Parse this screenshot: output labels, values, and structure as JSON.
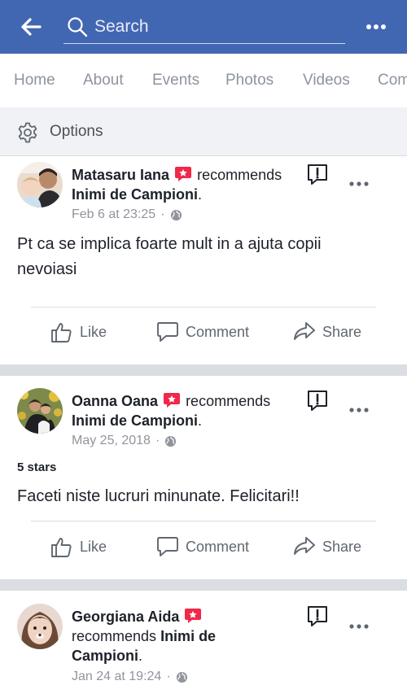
{
  "header": {
    "back_icon": "arrow-left-icon",
    "search_placeholder": "Search",
    "more_icon": "more-horizontal-icon",
    "background_color": "#4267b2"
  },
  "tabs": [
    "Home",
    "About",
    "Events",
    "Photos",
    "Videos",
    "Com"
  ],
  "options": {
    "label": "Options",
    "icon": "gear-icon"
  },
  "actions": {
    "like": "Like",
    "comment": "Comment",
    "share": "Share"
  },
  "posts": [
    {
      "author": "Matasaru Iana",
      "recommends": "recommends",
      "page": "Inimi de Campioni",
      "period": ".",
      "timestamp": "Feb 6 at 23:25",
      "separator": "·",
      "body": "Pt ca se implica foarte mult in a ajuta copii nevoiasi"
    },
    {
      "author": "Oanna Oana",
      "recommends": "recommends",
      "page": "Inimi de Campioni",
      "period": ".",
      "timestamp": "May 25, 2018",
      "separator": "·",
      "rating": "5 stars",
      "body": "Faceti niste lucruri minunate. Felicitari!!"
    },
    {
      "author": "Georgiana Aida",
      "recommends": "recommends",
      "page_line1": "Inimi de",
      "page_line2": "Campioni",
      "period": ".",
      "timestamp": "Jan 24 at 19:24",
      "separator": "·"
    }
  ],
  "colors": {
    "brand": "#4267b2",
    "recommend_badge": "#f0284a",
    "muted_text": "#90949c",
    "action_text": "#606770",
    "divider": "#dadde1"
  }
}
